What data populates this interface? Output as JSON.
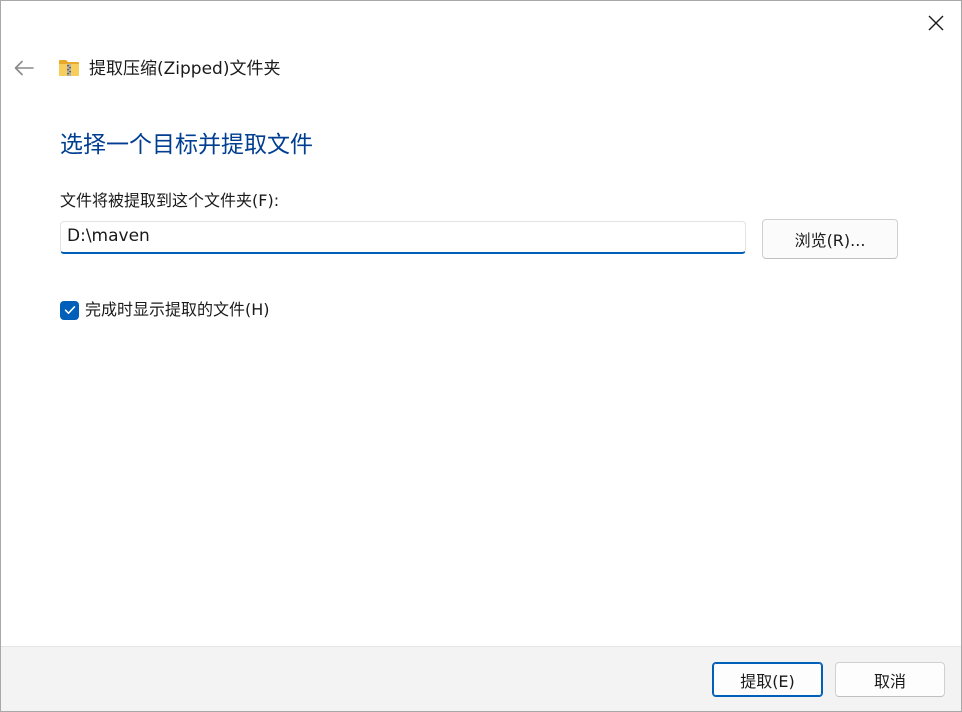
{
  "header": {
    "title": "提取压缩(Zipped)文件夹",
    "back_icon": "arrow-left-icon",
    "folder_icon": "zip-folder-icon",
    "close_icon": "close-icon"
  },
  "main": {
    "heading": "选择一个目标并提取文件",
    "destination_label": "文件将被提取到这个文件夹(F):",
    "destination_value": "D:\\maven",
    "browse_label": "浏览(R)...",
    "show_files_label": "完成时显示提取的文件(H)",
    "show_files_checked": true
  },
  "footer": {
    "extract_label": "提取(E)",
    "cancel_label": "取消"
  },
  "colors": {
    "accent": "#005fb8",
    "heading": "#003e92",
    "footer_bg": "#f3f3f3"
  }
}
